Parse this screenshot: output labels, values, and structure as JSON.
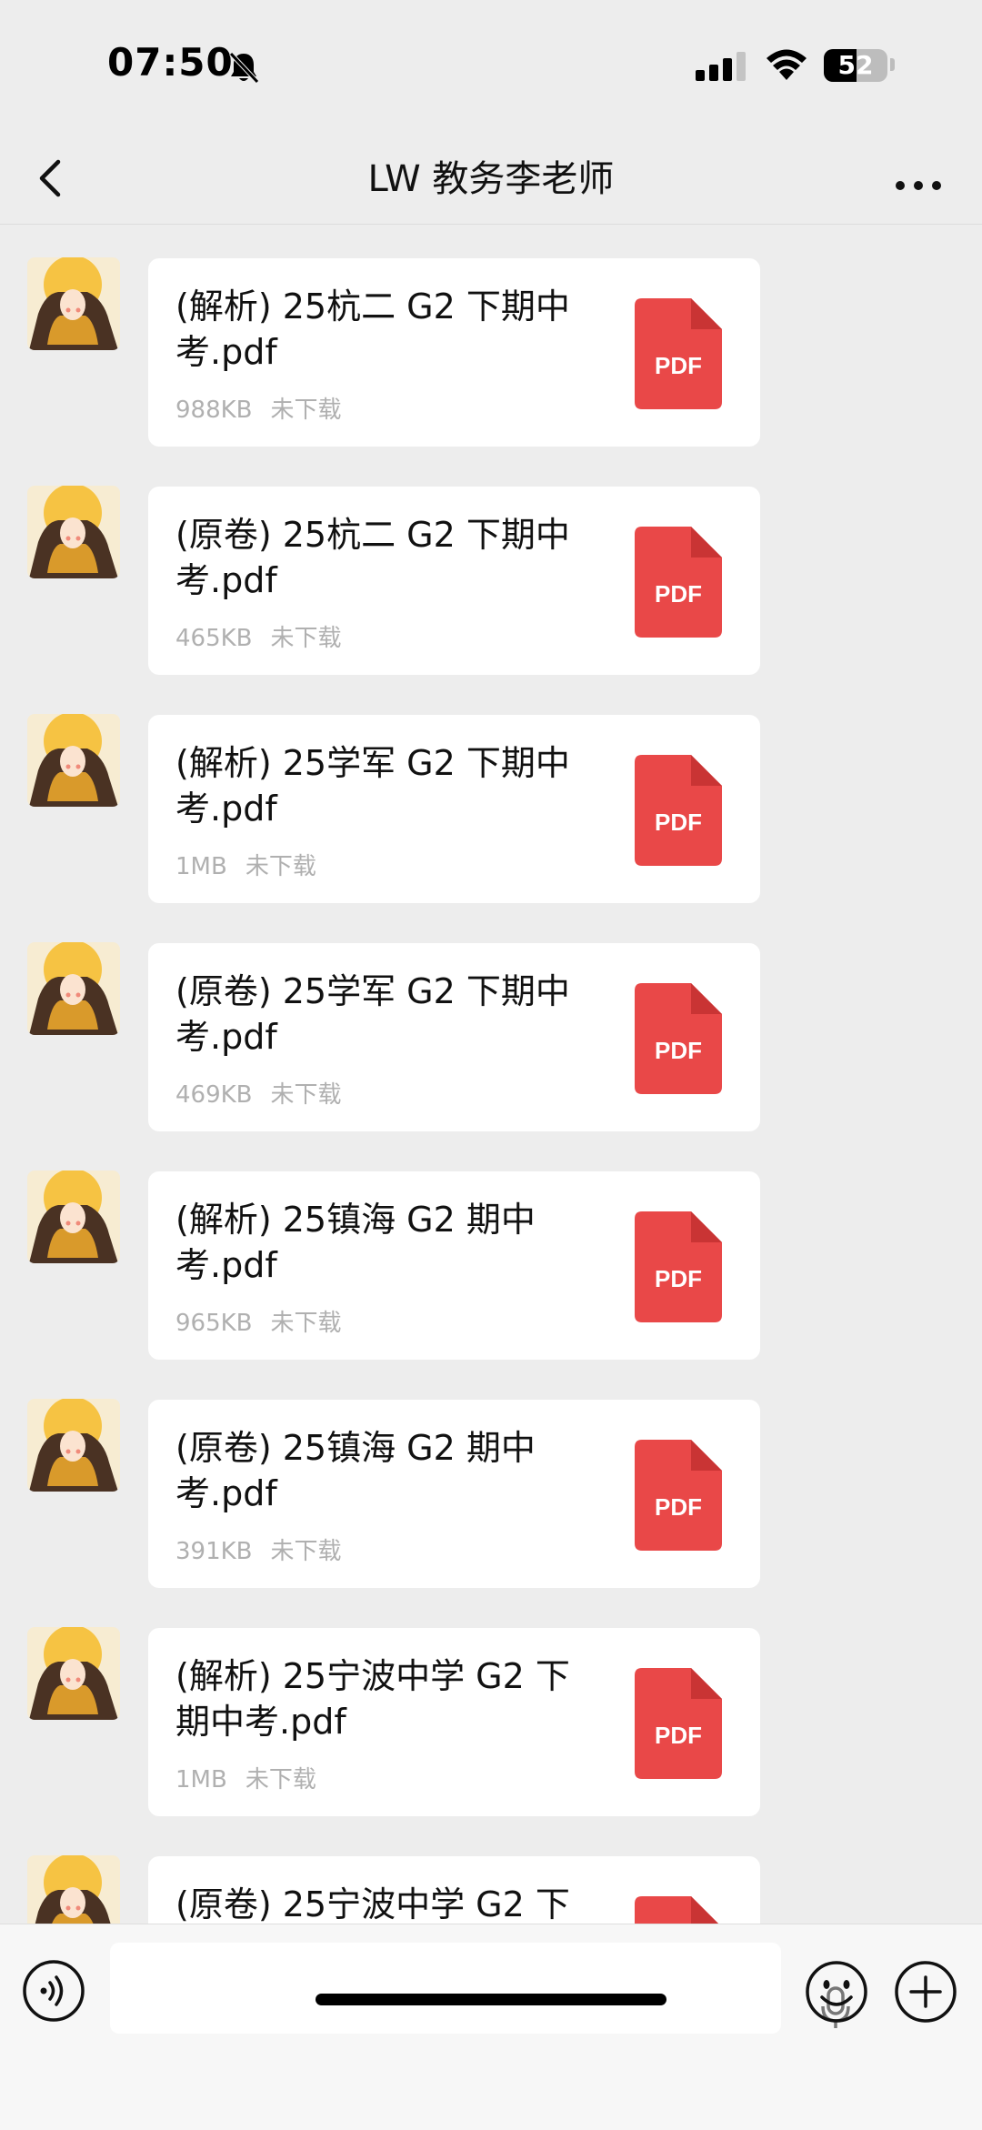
{
  "status_bar": {
    "time": "07:50",
    "battery": "52",
    "icons": [
      "bell-muted-icon",
      "cellular-signal-icon",
      "wifi-icon",
      "battery-icon"
    ]
  },
  "header": {
    "title": "LW 教务李老师",
    "back_icon": "chevron-left-icon",
    "more_icon": "ellipsis-icon"
  },
  "messages": [
    {
      "file_name": "(解析) 25杭二 G2 下期中考.pdf",
      "size": "988KB",
      "status": "未下载",
      "icon_label": "PDF"
    },
    {
      "file_name": "(原卷) 25杭二 G2 下期中考.pdf",
      "size": "465KB",
      "status": "未下载",
      "icon_label": "PDF"
    },
    {
      "file_name": "(解析) 25学军 G2 下期中考.pdf",
      "size": "1MB",
      "status": "未下载",
      "icon_label": "PDF"
    },
    {
      "file_name": "(原卷) 25学军 G2 下期中考.pdf",
      "size": "469KB",
      "status": "未下载",
      "icon_label": "PDF"
    },
    {
      "file_name": "(解析) 25镇海 G2 期中考.pdf",
      "size": "965KB",
      "status": "未下载",
      "icon_label": "PDF"
    },
    {
      "file_name": "(原卷) 25镇海 G2 期中考.pdf",
      "size": "391KB",
      "status": "未下载",
      "icon_label": "PDF"
    },
    {
      "file_name": "(解析) 25宁波中学 G2 下期中考.pdf",
      "size": "1MB",
      "status": "未下载",
      "icon_label": "PDF"
    },
    {
      "file_name": "(原卷) 25宁波中学 G2 下",
      "size": "",
      "status": "",
      "icon_label": ""
    }
  ],
  "input_bar": {
    "icons": [
      "voice-wave-icon",
      "microphone-icon",
      "emoji-icon",
      "plus-icon"
    ]
  },
  "colors": {
    "background": "#ededed",
    "pdf_red": "#e94848",
    "pdf_fold": "#c93434",
    "meta_gray": "#b0b0b0"
  }
}
